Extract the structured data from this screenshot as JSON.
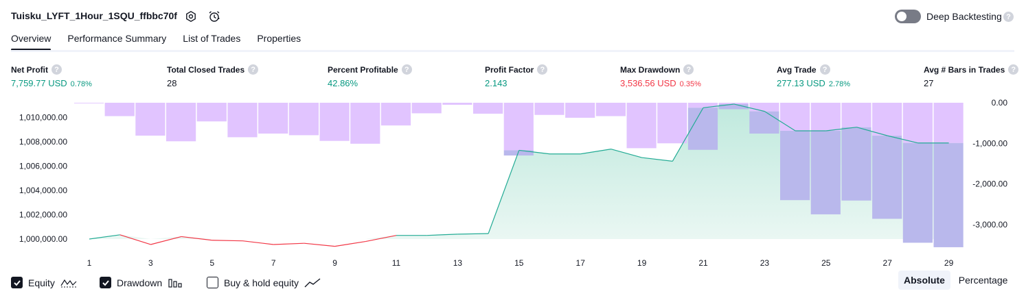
{
  "header": {
    "title": "Tuisku_LYFT_1Hour_1SQU_ffbbc70f",
    "deep_backtesting_label": "Deep Backtesting",
    "help_glyph": "?"
  },
  "tabs": [
    "Overview",
    "Performance Summary",
    "List of Trades",
    "Properties"
  ],
  "metrics": [
    {
      "label": "Net Profit",
      "value": "7,759.77 USD",
      "pct": "0.78%",
      "color": "green"
    },
    {
      "label": "Total Closed Trades",
      "value": "28",
      "pct": "",
      "color": "dark"
    },
    {
      "label": "Percent Profitable",
      "value": "42.86%",
      "pct": "",
      "color": "green"
    },
    {
      "label": "Profit Factor",
      "value": "2.143",
      "pct": "",
      "color": "green"
    },
    {
      "label": "Max Drawdown",
      "value": "3,536.56 USD",
      "pct": "0.35%",
      "color": "red"
    },
    {
      "label": "Avg Trade",
      "value": "277.13 USD",
      "pct": "2.78%",
      "color": "green"
    },
    {
      "label": "Avg # Bars in Trades",
      "value": "27",
      "pct": "",
      "color": "dark"
    }
  ],
  "legend": {
    "equity": "Equity",
    "drawdown": "Drawdown",
    "buyhold": "Buy & hold equity",
    "equity_checked": true,
    "drawdown_checked": true,
    "buyhold_checked": false
  },
  "scale_toggle": {
    "absolute": "Absolute",
    "percentage": "Percentage",
    "selected": "Absolute"
  },
  "colors": {
    "equity_up": "#22ab94",
    "equity_down": "#f23645",
    "equity_fill": "#d6f1ea",
    "drawdown_bar": "#e1c4ff",
    "drawdown_overlap": "#b9b8ec",
    "text": "#131722"
  },
  "chart_data": {
    "type": "line",
    "x": [
      1,
      2,
      3,
      4,
      5,
      6,
      7,
      8,
      9,
      10,
      11,
      12,
      13,
      14,
      15,
      16,
      17,
      18,
      19,
      20,
      21,
      22,
      23,
      24,
      25,
      26,
      27,
      28,
      29
    ],
    "x_tick_labels": [
      "1",
      "3",
      "5",
      "7",
      "9",
      "11",
      "13",
      "15",
      "17",
      "19",
      "21",
      "23",
      "25",
      "27",
      "29"
    ],
    "series": [
      {
        "name": "Equity",
        "axis": "left",
        "values": [
          1000000,
          1000350,
          999550,
          1000200,
          999900,
          999850,
          999550,
          999650,
          999400,
          999800,
          1000300,
          1000300,
          1000400,
          1000450,
          1007300,
          1007000,
          1007000,
          1007400,
          1006700,
          1006400,
          1010800,
          1011100,
          1010500,
          1008900,
          1008900,
          1009200,
          1008500,
          1007900,
          1007900
        ]
      },
      {
        "name": "Drawdown",
        "axis": "right",
        "type": "bar",
        "values": [
          -15,
          -330,
          -810,
          -950,
          -460,
          -850,
          -760,
          -800,
          -940,
          -1010,
          -560,
          -260,
          -50,
          -270,
          -1300,
          -300,
          -370,
          -330,
          -1120,
          -1000,
          -1160,
          -160,
          -760,
          -2400,
          -2750,
          -2410,
          -2860,
          -3450,
          -3560
        ]
      }
    ],
    "y_left": {
      "ticks": [
        1000000,
        1002000,
        1004000,
        1006000,
        1008000,
        1010000
      ],
      "tick_labels": [
        "1,000,000.00",
        "1,002,000.00",
        "1,004,000.00",
        "1,006,000.00",
        "1,008,000.00",
        "1,010,000.00"
      ],
      "range": [
        999000,
        1011200
      ]
    },
    "y_right": {
      "ticks": [
        0,
        -1000,
        -2000,
        -3000
      ],
      "tick_labels": [
        "0.00",
        "-1,000.00",
        "-2,000.00",
        "-3,000.00"
      ],
      "range": [
        -3600,
        0
      ]
    },
    "grid": false,
    "xlabel": "",
    "ylabel": ""
  }
}
